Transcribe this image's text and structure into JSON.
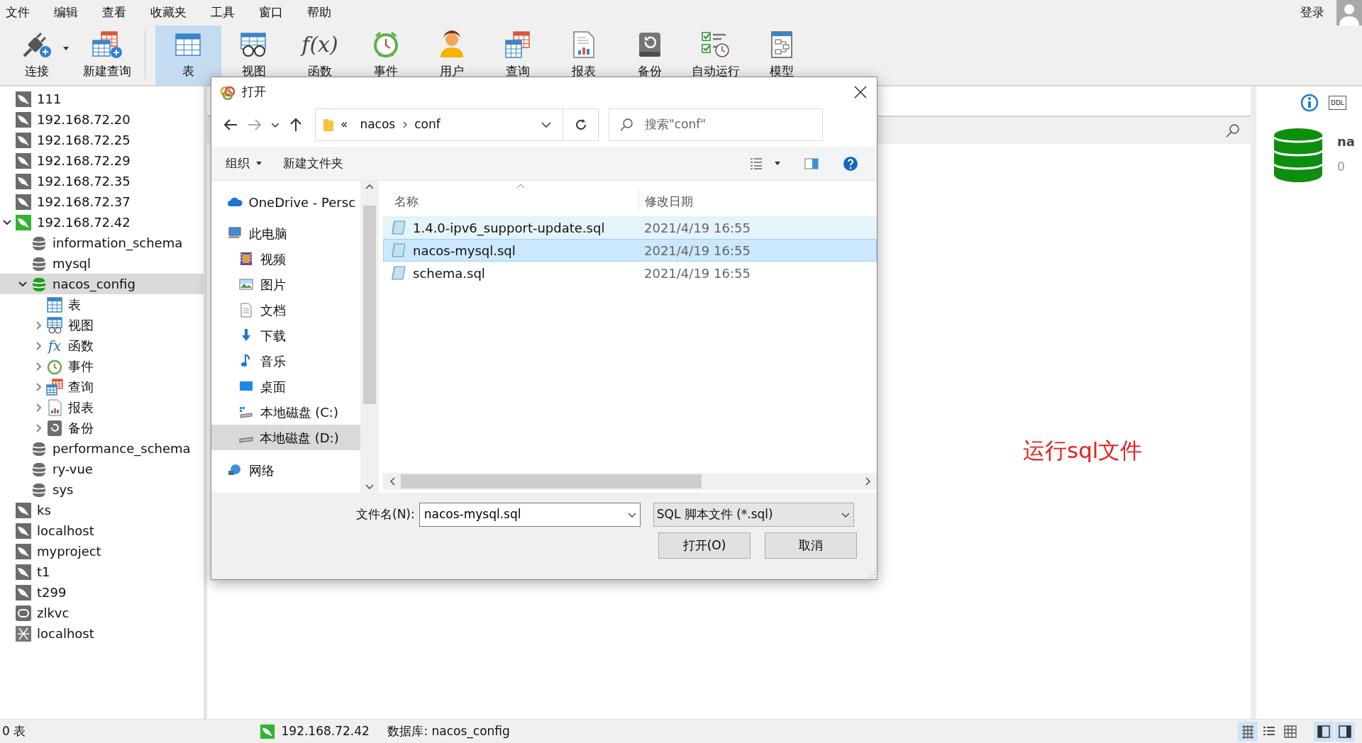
{
  "menu": [
    "文件",
    "编辑",
    "查看",
    "收藏夹",
    "工具",
    "窗口",
    "帮助"
  ],
  "account": {
    "label": "登录"
  },
  "toolbar": {
    "connection_group": [
      {
        "kind": "connect",
        "label": "连接",
        "has_menu": true
      },
      {
        "kind": "new-query",
        "label": "新建查询",
        "has_menu": false
      }
    ],
    "objects": [
      {
        "kind": "table",
        "label": "表",
        "selected": true
      },
      {
        "kind": "view",
        "label": "视图",
        "selected": false
      },
      {
        "kind": "function",
        "label": "函数",
        "glyph": "f(x)",
        "selected": false
      },
      {
        "kind": "event",
        "label": "事件",
        "selected": false
      },
      {
        "kind": "user",
        "label": "用户",
        "selected": false
      },
      {
        "kind": "query",
        "label": "查询",
        "selected": false
      },
      {
        "kind": "report",
        "label": "报表",
        "selected": false
      },
      {
        "kind": "backup",
        "label": "备份",
        "selected": false
      },
      {
        "kind": "autorun",
        "label": "自动运行",
        "selected": false
      },
      {
        "kind": "model",
        "label": "模型",
        "selected": false
      }
    ]
  },
  "tree": [
    {
      "kind": "mysql",
      "label": "111",
      "open": false,
      "selected": false
    },
    {
      "kind": "mysql",
      "label": "192.168.72.20",
      "open": false,
      "selected": false
    },
    {
      "kind": "mysql",
      "label": "192.168.72.25",
      "open": false,
      "selected": false
    },
    {
      "kind": "mysql",
      "label": "192.168.72.29",
      "open": false,
      "selected": false
    },
    {
      "kind": "mysql",
      "label": "192.168.72.35",
      "open": false,
      "selected": false
    },
    {
      "kind": "mysql",
      "label": "192.168.72.37",
      "open": false,
      "selected": false
    },
    {
      "kind": "mysql",
      "label": "192.168.72.42",
      "open": true,
      "expanded": true,
      "selected": false,
      "children": [
        {
          "kind": "database",
          "label": "information_schema",
          "open": false,
          "selected": false
        },
        {
          "kind": "database",
          "label": "mysql",
          "open": false,
          "selected": false
        },
        {
          "kind": "database",
          "label": "nacos_config",
          "open": true,
          "expanded": true,
          "selected": true,
          "children": [
            {
              "kind": "tables",
              "label": "表",
              "selected": false
            },
            {
              "kind": "views",
              "label": "视图",
              "expanded": false,
              "selected": false
            },
            {
              "kind": "functions",
              "label": "函数",
              "glyph": "fx",
              "expanded": false,
              "selected": false
            },
            {
              "kind": "events",
              "label": "事件",
              "expanded": false,
              "selected": false
            },
            {
              "kind": "queries",
              "label": "查询",
              "expanded": false,
              "selected": false
            },
            {
              "kind": "reports",
              "label": "报表",
              "expanded": false,
              "selected": false
            },
            {
              "kind": "backups",
              "label": "备份",
              "expanded": false,
              "selected": false
            }
          ]
        },
        {
          "kind": "database",
          "label": "performance_schema",
          "open": false,
          "selected": false
        },
        {
          "kind": "database",
          "label": "ry-vue",
          "open": false,
          "selected": false
        },
        {
          "kind": "database",
          "label": "sys",
          "open": false,
          "selected": false
        }
      ]
    },
    {
      "kind": "mysql",
      "label": "ks",
      "open": false,
      "selected": false
    },
    {
      "kind": "mysql",
      "label": "localhost",
      "open": false,
      "selected": false
    },
    {
      "kind": "mysql",
      "label": "myproject",
      "open": false,
      "selected": false
    },
    {
      "kind": "mysql",
      "label": "t1",
      "open": false,
      "selected": false
    },
    {
      "kind": "mysql",
      "label": "t299",
      "open": false,
      "selected": false
    },
    {
      "kind": "oval-server",
      "label": "zlkvc",
      "open": false,
      "selected": false
    },
    {
      "kind": "net-server",
      "label": "localhost",
      "open": false,
      "selected": false
    }
  ],
  "main": {
    "annotation": "运行sql文件"
  },
  "info_panel": {
    "ddl_label": "DDL",
    "name": "na",
    "count": "0"
  },
  "dialog": {
    "title": "打开",
    "path": {
      "overflow": "«",
      "segments": [
        "nacos",
        "conf"
      ]
    },
    "search": {
      "placeholder": "搜索\"conf\""
    },
    "commands": [
      {
        "label": "组织",
        "has_menu": true
      },
      {
        "label": "新建文件夹",
        "has_menu": false
      }
    ],
    "nav": [
      {
        "kind": "onedrive",
        "label": "OneDrive - Persc",
        "selected": false
      },
      {
        "kind": "computer",
        "label": "此电脑",
        "selected": false,
        "children": [
          {
            "kind": "videos",
            "label": "视频",
            "selected": false
          },
          {
            "kind": "pictures",
            "label": "图片",
            "selected": false
          },
          {
            "kind": "documents",
            "label": "文档",
            "selected": false
          },
          {
            "kind": "downloads",
            "label": "下载",
            "selected": false
          },
          {
            "kind": "music",
            "label": "音乐",
            "selected": false
          },
          {
            "kind": "desktop",
            "label": "桌面",
            "selected": false
          },
          {
            "kind": "system-drive",
            "label": "本地磁盘 (C:)",
            "selected": false
          },
          {
            "kind": "drive",
            "label": "本地磁盘 (D:)",
            "selected": true
          }
        ]
      },
      {
        "kind": "network",
        "label": "网络",
        "selected": false
      }
    ],
    "columns": [
      "名称",
      "修改日期"
    ],
    "files": [
      {
        "name": "1.4.0-ipv6_support-update.sql",
        "date": "2021/4/19 16:55",
        "selected": false,
        "hovered": true
      },
      {
        "name": "nacos-mysql.sql",
        "date": "2021/4/19 16:55",
        "selected": true,
        "hovered": false
      },
      {
        "name": "schema.sql",
        "date": "2021/4/19 16:55",
        "selected": false,
        "hovered": false
      }
    ],
    "filename": {
      "label": "文件名(N):",
      "value": "nacos-mysql.sql"
    },
    "filter": {
      "value": "SQL 脚本文件 (*.sql)"
    },
    "buttons": [
      "打开(O)",
      "取消"
    ]
  },
  "status_bar": {
    "summary": "0 表",
    "connection": "192.168.72.42",
    "database": "数据库: nacos_config",
    "views": [
      {
        "kind": "grid",
        "selected": true
      },
      {
        "kind": "list",
        "selected": false
      },
      {
        "kind": "er",
        "selected": false
      }
    ],
    "panes": [
      {
        "kind": "left",
        "on": true
      },
      {
        "kind": "right",
        "on": true
      }
    ]
  }
}
